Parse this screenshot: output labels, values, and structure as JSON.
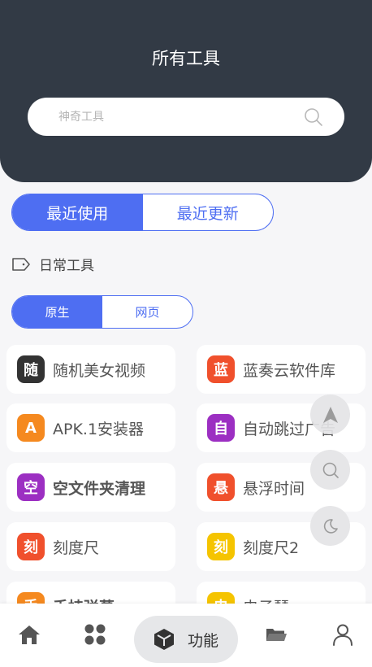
{
  "header": {
    "title": "所有工具"
  },
  "search": {
    "placeholder": "神奇工具"
  },
  "tabs": {
    "recent_used": "最近使用",
    "recent_updated": "最近更新"
  },
  "category": {
    "label": "日常工具"
  },
  "subtabs": {
    "native": "原生",
    "web": "网页"
  },
  "tools": [
    {
      "badge": "随",
      "name": "随机美女视频",
      "color": "#333333",
      "bold": false
    },
    {
      "badge": "蓝",
      "name": "蓝奏云软件库",
      "color": "#f0502c",
      "bold": false
    },
    {
      "badge": "A",
      "name": "APK.1安装器",
      "color": "#f5891f",
      "bold": false
    },
    {
      "badge": "自",
      "name": "自动跳过广告",
      "color": "#9c2fc2",
      "bold": false
    },
    {
      "badge": "空",
      "name": "空文件夹清理",
      "color": "#9c2fc2",
      "bold": true
    },
    {
      "badge": "悬",
      "name": "悬浮时间",
      "color": "#f0502c",
      "bold": false
    },
    {
      "badge": "刻",
      "name": "刻度尺",
      "color": "#f0502c",
      "bold": false
    },
    {
      "badge": "刻",
      "name": "刻度尺2",
      "color": "#f5c400",
      "bold": false
    },
    {
      "badge": "手",
      "name": "手持弹幕",
      "color": "#f5891f",
      "bold": true
    },
    {
      "badge": "电",
      "name": "电子琴",
      "color": "#f5c400",
      "bold": false
    }
  ],
  "bottom_nav": {
    "active_label": "功能"
  },
  "colors": {
    "accent": "#4e6ef2",
    "header_bg": "#323a45"
  }
}
